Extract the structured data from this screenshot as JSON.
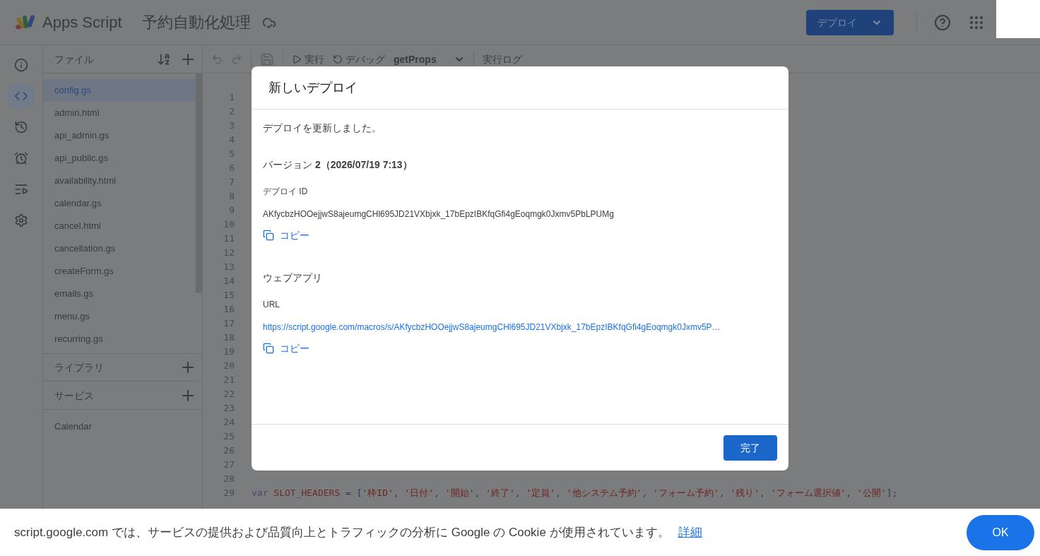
{
  "header": {
    "app_name": "Apps Script",
    "project_title": "予約自動化処理",
    "deploy_button": "デプロイ"
  },
  "rail": [
    {
      "kind": "info",
      "selected": false
    },
    {
      "kind": "code",
      "selected": true
    },
    {
      "kind": "history",
      "selected": false
    },
    {
      "kind": "triggers",
      "selected": false
    },
    {
      "kind": "executions",
      "selected": false
    },
    {
      "kind": "settings",
      "selected": false
    }
  ],
  "files_panel": {
    "title": "ファイル",
    "files": [
      {
        "name": "config.gs",
        "selected": true
      },
      {
        "name": "admin.html",
        "selected": false
      },
      {
        "name": "api_admin.gs",
        "selected": false
      },
      {
        "name": "api_public.gs",
        "selected": false
      },
      {
        "name": "availability.html",
        "selected": false
      },
      {
        "name": "calendar.gs",
        "selected": false
      },
      {
        "name": "cancel.html",
        "selected": false
      },
      {
        "name": "cancellation.gs",
        "selected": false
      },
      {
        "name": "createForm.gs",
        "selected": false
      },
      {
        "name": "emails.gs",
        "selected": false
      },
      {
        "name": "menu.gs",
        "selected": false
      },
      {
        "name": "recurring.gs",
        "selected": false
      }
    ],
    "libraries_title": "ライブラリ",
    "services_title": "サービス",
    "services": [
      "Calendar"
    ]
  },
  "toolbar": {
    "run": "実行",
    "debug": "デバッグ",
    "function": "getProps",
    "log": "実行ログ"
  },
  "editor": {
    "lines": [
      {
        "number": "1"
      },
      {
        "number": "2"
      },
      {
        "number": "3"
      },
      {
        "number": "4"
      },
      {
        "number": "5"
      },
      {
        "number": "6"
      },
      {
        "number": "7"
      },
      {
        "number": "8"
      },
      {
        "number": "9"
      },
      {
        "number": "10"
      },
      {
        "number": "11"
      },
      {
        "number": "12"
      },
      {
        "number": "13"
      },
      {
        "number": "14"
      },
      {
        "number": "15"
      },
      {
        "number": "16"
      },
      {
        "number": "17"
      },
      {
        "number": "18"
      },
      {
        "number": "19"
      },
      {
        "number": "20"
      },
      {
        "number": "21"
      },
      {
        "number": "22"
      },
      {
        "number": "23"
      },
      {
        "number": "24"
      },
      {
        "number": "25"
      },
      {
        "number": "26"
      },
      {
        "number": "27"
      },
      {
        "number": "28"
      },
      {
        "number": "29",
        "tokens": [
          {
            "kind": "keyword",
            "text": "var"
          },
          {
            "kind": "variable",
            "text": " SLOT_HEADERS"
          },
          {
            "kind": "punct",
            "text": " = ["
          },
          {
            "kind": "string",
            "text": "'枠ID'"
          },
          {
            "kind": "punct",
            "text": ", "
          },
          {
            "kind": "string",
            "text": "'日付'"
          },
          {
            "kind": "punct",
            "text": ", "
          },
          {
            "kind": "string",
            "text": "'開始'"
          },
          {
            "kind": "punct",
            "text": ", "
          },
          {
            "kind": "string",
            "text": "'終了'"
          },
          {
            "kind": "punct",
            "text": ", "
          },
          {
            "kind": "string",
            "text": "'定員'"
          },
          {
            "kind": "punct",
            "text": ", "
          },
          {
            "kind": "string",
            "text": "'他システム予約'"
          },
          {
            "kind": "punct",
            "text": ", "
          },
          {
            "kind": "string",
            "text": "'フォーム予約'"
          },
          {
            "kind": "punct",
            "text": ", "
          },
          {
            "kind": "string",
            "text": "'残り'"
          },
          {
            "kind": "punct",
            "text": ", "
          },
          {
            "kind": "string",
            "text": "'フォーム選択値'"
          },
          {
            "kind": "punct",
            "text": ", "
          },
          {
            "kind": "string",
            "text": "'公開'"
          },
          {
            "kind": "punct",
            "text": "];"
          }
        ]
      }
    ]
  },
  "dialog": {
    "title": "新しいデプロイ",
    "message": "デプロイを更新しました。",
    "version": "バージョン **2（2026/07/19 7:13）**",
    "deploy_id_label": "デプロイ ID",
    "deploy_id": "AKfycbzHOOejjwS8ajeumgCHl695JD21VXbjxk_17bEpzIBKfqGfi4gEoqmgk0Jxmv5PbLPUMg",
    "copy_1": "コピー",
    "web_app_heading": "ウェブアプリ",
    "url_label": "URL",
    "url": "https://script.google.com/macros/s/AKfycbzHOOejjwS8ajeumgCHl695JD21VXbjxk_17bEpzIBKfqGfi4gEoqmgk0Jxmv5P…",
    "copy_2": "コピー",
    "done_button": "完了"
  },
  "cookie_bar": {
    "message": "script.google.com では、サービスの提供および品質向上とトラフィックの分析に Google の Cookie が使用されています。",
    "link": "詳細",
    "ok_button": "OK"
  }
}
